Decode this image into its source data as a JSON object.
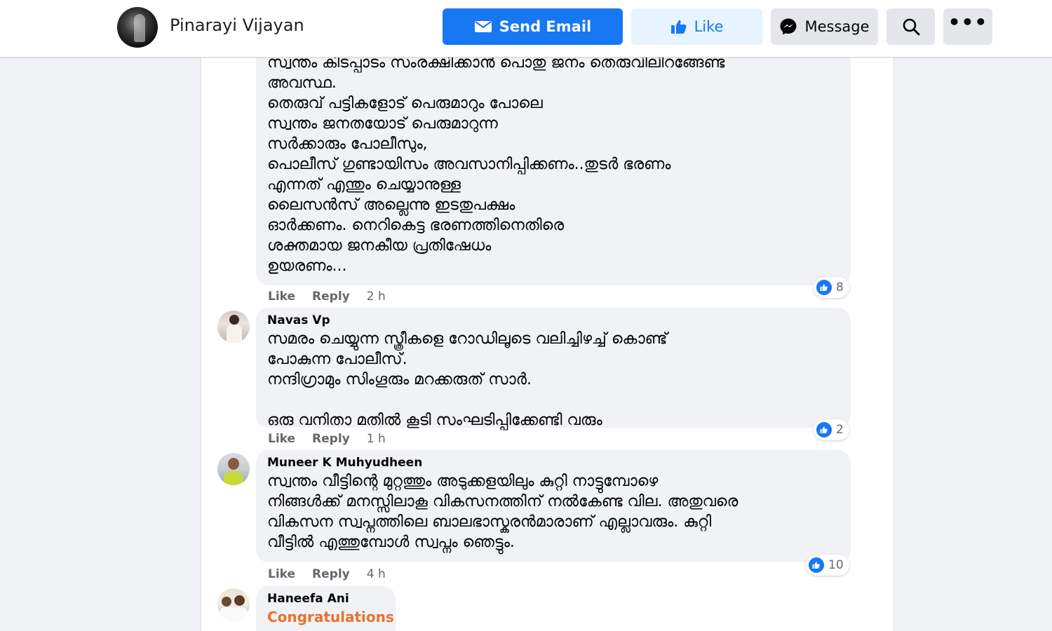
{
  "header": {
    "page_name": "Pinarayi Vijayan",
    "send_email_label": "Send Email",
    "like_label": "Like",
    "message_label": "Message"
  },
  "comments": [
    {
      "author": "",
      "text": "സ്വന്തം കിടപ്പാടം സംരക്ഷിക്കാൻ പൊതു ജനം തെരുവിലിറങ്ങേണ്ട\nഅവസ്ഥ.\nതെരുവ് പട്ടികളോട് പെരുമാറും പോലെ\nസ്വന്തം ജനതയോട് പെരുമാറുന്ന\nസർക്കാരും പോലീസും,\nപൊലീസ് ഗുണ്ടായിസം അവസാനിപ്പിക്കണം..തുടർ ഭരണം\nഎന്നത് എന്തും ചെയ്യാനുള്ള\nലൈസൻസ് അല്ലെന്നു ഇടതുപക്ഷം\nഓർക്കണം. നെറികെട്ട ഭരണത്തിനെതിരെ\nശക്തമായ ജനകീയ പ്രതിഷേധം\nഉയരണം...",
      "like": "Like",
      "reply": "Reply",
      "time": "2 h",
      "reactions": "8"
    },
    {
      "author": "Navas Vp",
      "text": "സമരം ചെയ്യുന്ന സ്ത്രീകളെ റോഡിലൂടെ വലിച്ചിഴച്ച് കൊണ്ട്\nപോകുന്ന പോലീസ്.\nനന്ദിഗ്രാമും സിംഗൂരും മറക്കരുത് സാർ.\n\nഒരു വനിതാ മതിൽ കൂടി സംഘടിപ്പിക്കേണ്ടി വരും",
      "like": "Like",
      "reply": "Reply",
      "time": "1 h",
      "reactions": "2"
    },
    {
      "author": "Muneer K Muhyudheen",
      "text": "സ്വന്തം വീട്ടിന്റെ മുറ്റത്തും അടുക്കളയിലും കുറ്റി നാട്ടുമ്പോഴെ\nനിങ്ങൾക്ക് മനസ്സിലാകൂ വികസനത്തിന് നൽകേണ്ട വില. അതുവരെ\nവികസന സ്വപ്നത്തിലെ ബാലഭാസ്കരൻമാരാണ് എല്ലാവരും. കുറ്റി\nവീട്ടിൽ എത്തുമ്പോൾ സ്വപ്നം ഞെട്ടും.",
      "like": "Like",
      "reply": "Reply",
      "time": "4 h",
      "reactions": "10"
    },
    {
      "author": "Haneefa Ani",
      "text": "Congratulations"
    }
  ],
  "colors": {
    "brand_blue": "#1877f2",
    "accent_orange": "#e8722c",
    "bubble_bg": "#f0f2f5"
  },
  "icons": [
    "envelope-icon",
    "thumbs-up-icon",
    "messenger-icon",
    "search-icon",
    "more-dots-icon"
  ]
}
